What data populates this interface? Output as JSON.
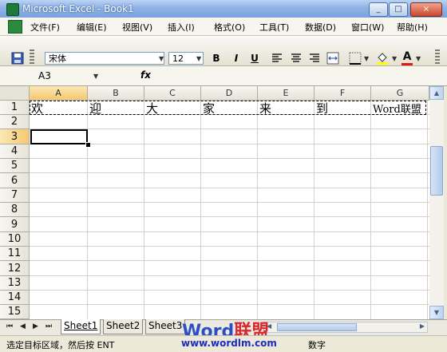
{
  "window": {
    "title": "Microsoft Excel - Book1",
    "buttons": [
      "_",
      "□",
      "×"
    ]
  },
  "menu": {
    "items": [
      "文件(F)",
      "编辑(E)",
      "视图(V)",
      "插入(I)",
      "格式(O)",
      "工具(T)",
      "数据(D)",
      "窗口(W)",
      "帮助(H)"
    ],
    "mdi_buttons": [
      "_",
      "▫",
      "×"
    ]
  },
  "toolbar": {
    "font_name": "宋体",
    "font_size": "12",
    "bold": "B",
    "italic": "I",
    "underline": "U"
  },
  "formula_bar": {
    "name_box": "A3",
    "fx": "fx"
  },
  "sheet": {
    "columns": [
      "A",
      "B",
      "C",
      "D",
      "E",
      "F",
      "G"
    ],
    "rows": [
      "1",
      "2",
      "3",
      "4",
      "5",
      "6",
      "7",
      "8",
      "9",
      "10",
      "11",
      "12",
      "13",
      "14",
      "15"
    ],
    "row1": [
      "欢",
      "迎",
      "大",
      "家",
      "来",
      "到",
      "Word联盟"
    ],
    "selected_cell": "A3"
  },
  "tabs": {
    "sheets": [
      "Sheet1",
      "Sheet2",
      "Sheet3"
    ],
    "nav": [
      "⏮",
      "◀",
      "▶",
      "⏭"
    ]
  },
  "status": {
    "message": "选定目标区域，然后按 ENT",
    "mode": "数字"
  },
  "watermark": {
    "word": "Word",
    "cn": "联盟",
    "url": "www.wordlm.com"
  },
  "colors": {
    "title_text": "#ffffff",
    "watermark_w": "#2d4fc6",
    "watermark_ord": "#e87a1a",
    "watermark_cn": "#d8272d",
    "selected_header": "#f5c96f"
  }
}
